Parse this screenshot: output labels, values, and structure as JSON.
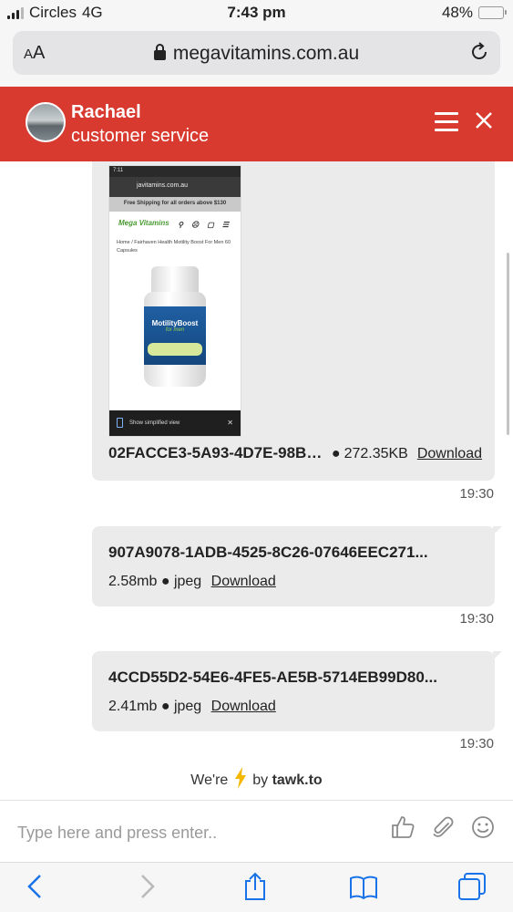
{
  "status_bar": {
    "carrier": "Circles",
    "network": "4G",
    "time": "7:43 pm",
    "battery": "48%",
    "battery_level": 0.48
  },
  "browser": {
    "text_size_label_small": "A",
    "text_size_label_large": "A",
    "url": "megavitamins.com.au"
  },
  "chat_header": {
    "agent_name": "Rachael",
    "agent_role": "customer service",
    "color": "#d93a2f"
  },
  "messages": [
    {
      "type": "image",
      "file_name": "02FACCE3-5A93-4D7E-98BA-...",
      "size": "272.35KB",
      "download_label": "Download",
      "timestamp": "19:30",
      "thumbnail": {
        "time": "7:11",
        "url": "javitamins.com.au",
        "shipping_banner": "Free Shipping for all orders above $130",
        "logo": "Mega Vitamins",
        "breadcrumb": "Home / Fairhaven Health Motility Boost For Men 60 Capsules",
        "product_title": "MotilityBoost",
        "product_sub": "for men",
        "bottom_bar": "Show simplified view"
      }
    },
    {
      "type": "file",
      "file_name": "907A9078-1ADB-4525-8C26-07646EEC271...",
      "size": "2.58mb",
      "format": "jpeg",
      "download_label": "Download",
      "timestamp": "19:30"
    },
    {
      "type": "file",
      "file_name": "4CCD55D2-54E6-4FE5-AE5B-5714EB99D80...",
      "size": "2.41mb",
      "format": "jpeg",
      "download_label": "Download",
      "timestamp": "19:30"
    }
  ],
  "powered_by": {
    "prefix": "We're",
    "suffix": "by",
    "brand": "tawk.to",
    "bolt_color": "#f5b800"
  },
  "input": {
    "placeholder": "Type here and press enter.."
  },
  "toolbar_icons": [
    "back-icon",
    "forward-icon",
    "share-icon",
    "bookmarks-icon",
    "tabs-icon"
  ],
  "accent_blue": "#1a73e8"
}
